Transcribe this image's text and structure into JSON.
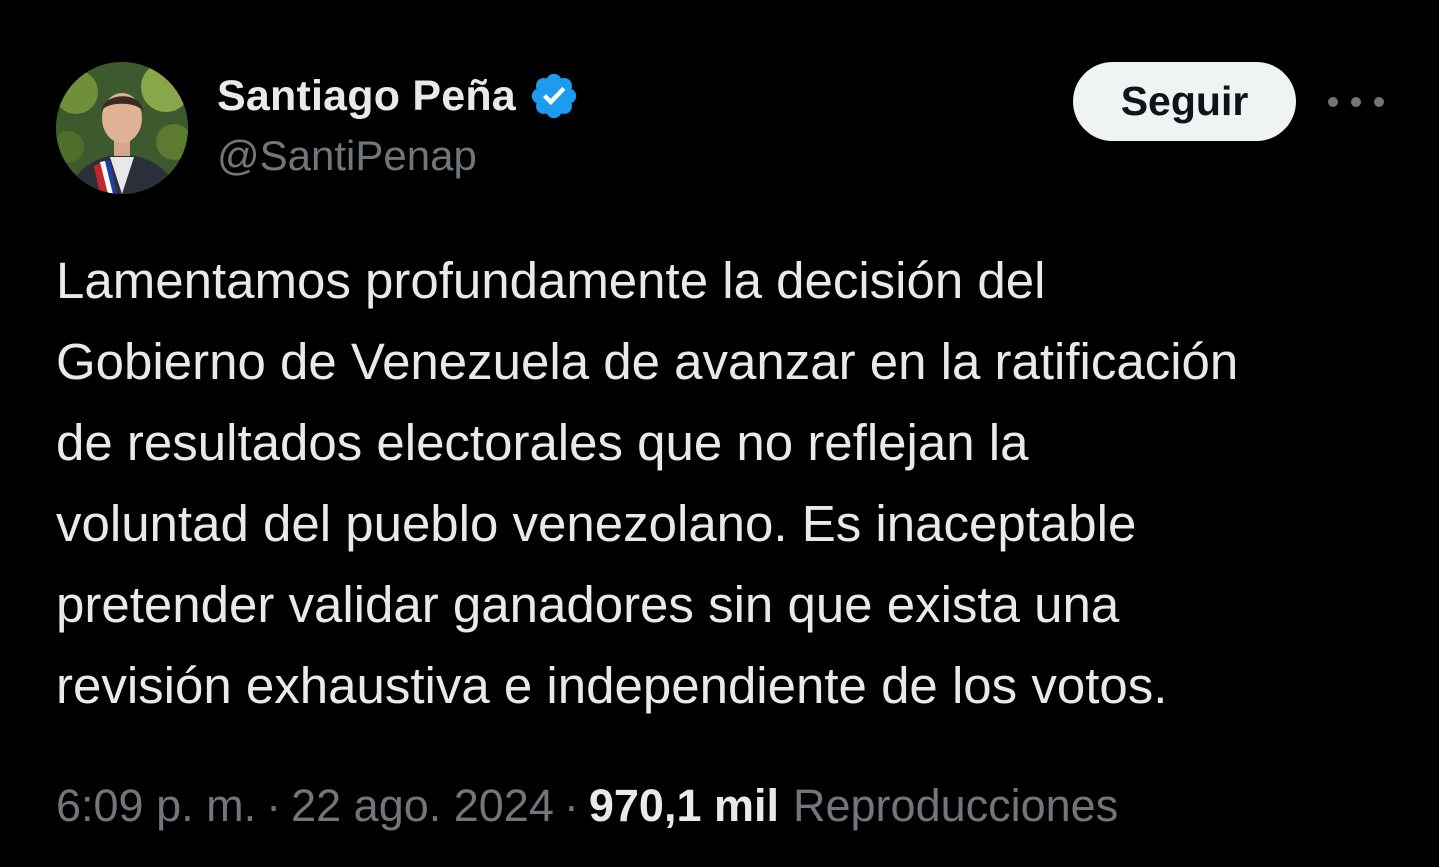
{
  "author": {
    "display_name": "Santiago Peña",
    "handle": "@SantiPenap",
    "verified_icon": "verified-badge-icon"
  },
  "actions": {
    "follow_label": "Seguir",
    "more_icon": "more-options-icon"
  },
  "tweet": {
    "lines": [
      "Lamentamos profundamente la decisión del",
      "Gobierno de Venezuela de avanzar en la ratificación",
      "de resultados electorales que no reflejan la",
      "voluntad del pueblo venezolano. Es inaceptable",
      "pretender validar ganadores sin que exista una",
      "revisión exhaustiva e independiente de los votos."
    ]
  },
  "meta": {
    "time": "6:09 p. m.",
    "separator": "·",
    "date": "22 ago. 2024",
    "views_count": "970,1 mil",
    "views_label": "Reproducciones"
  },
  "colors": {
    "background": "#000000",
    "primary_text": "#e7e9ea",
    "secondary_text": "#71767b",
    "verified_blue": "#1d9bf0",
    "button_bg": "#eff3f4"
  }
}
